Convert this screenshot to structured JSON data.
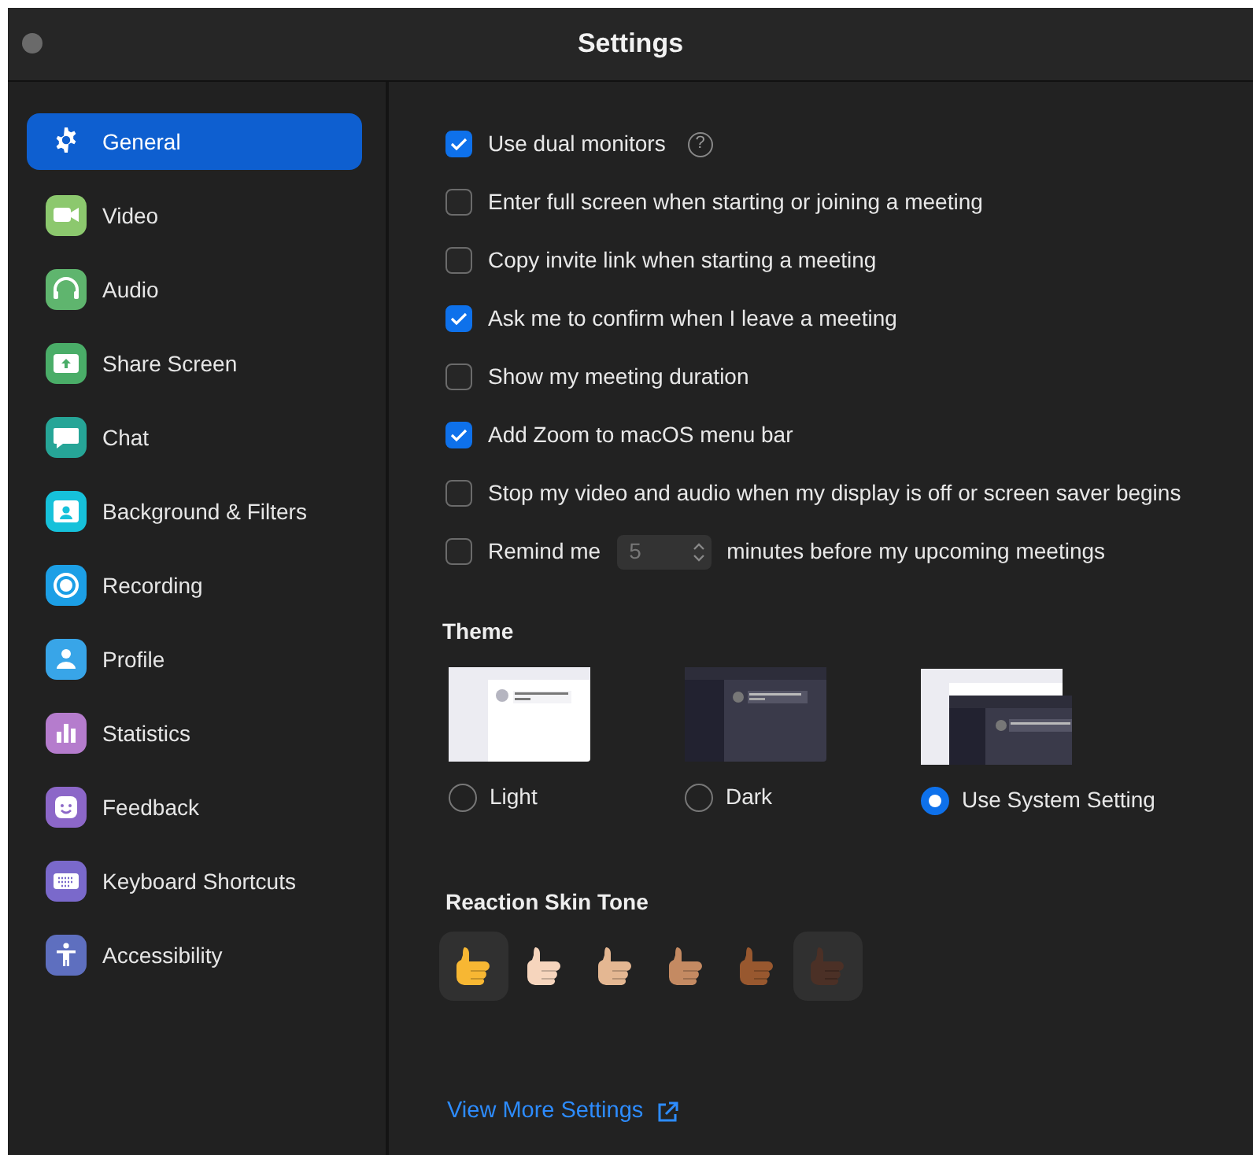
{
  "window": {
    "title": "Settings"
  },
  "sidebar": {
    "items": [
      {
        "label": "General",
        "kind": "gear",
        "selected": true
      },
      {
        "label": "Video",
        "kind": "video",
        "selected": false,
        "color": "#8cc86e"
      },
      {
        "label": "Audio",
        "kind": "headphones",
        "selected": false,
        "color": "#5fb56e"
      },
      {
        "label": "Share Screen",
        "kind": "share",
        "selected": false,
        "color": "#4aad68"
      },
      {
        "label": "Chat",
        "kind": "chat",
        "selected": false,
        "color": "#26a597"
      },
      {
        "label": "Background & Filters",
        "kind": "portrait",
        "selected": false,
        "color": "#16c1da"
      },
      {
        "label": "Recording",
        "kind": "record",
        "selected": false,
        "color": "#1c9fe6"
      },
      {
        "label": "Profile",
        "kind": "person",
        "selected": false,
        "color": "#38a5e8"
      },
      {
        "label": "Statistics",
        "kind": "bars",
        "selected": false,
        "color": "#b57ccd"
      },
      {
        "label": "Feedback",
        "kind": "smile",
        "selected": false,
        "color": "#8c67c8"
      },
      {
        "label": "Keyboard Shortcuts",
        "kind": "keyboard",
        "selected": false,
        "color": "#7a69cb"
      },
      {
        "label": "Accessibility",
        "kind": "accessibility",
        "selected": false,
        "color": "#5e6fbf"
      }
    ]
  },
  "options": [
    {
      "kind": "checkbox",
      "label": "Use dual monitors",
      "checked": true,
      "help": "?"
    },
    {
      "kind": "checkbox",
      "label": "Enter full screen when starting or joining a meeting",
      "checked": false
    },
    {
      "kind": "checkbox",
      "label": "Copy invite link when starting a meeting",
      "checked": false
    },
    {
      "kind": "checkbox",
      "label": "Ask me to confirm when I leave a meeting",
      "checked": true
    },
    {
      "kind": "checkbox",
      "label": "Show my meeting duration",
      "checked": false
    },
    {
      "kind": "checkbox",
      "label": "Add Zoom to macOS menu bar",
      "checked": true
    },
    {
      "kind": "checkbox",
      "label": "Stop my video and audio when my display is off or screen saver begins",
      "checked": false
    },
    {
      "kind": "stepper",
      "label": "Remind me",
      "value": "5",
      "suffix": "minutes before my upcoming meetings",
      "checked": false,
      "disabled": true
    }
  ],
  "theme": {
    "heading": "Theme",
    "choices": [
      {
        "label": "Light",
        "kind": "light",
        "selected": false
      },
      {
        "label": "Dark",
        "kind": "dark",
        "selected": false
      },
      {
        "label": "Use System Setting",
        "kind": "system",
        "selected": true
      }
    ]
  },
  "skin_tone": {
    "heading": "Reaction Skin Tone",
    "tones": [
      {
        "color": "#f7b733",
        "highlighted": true
      },
      {
        "color": "#f6d5bd",
        "highlighted": false
      },
      {
        "color": "#e4b792",
        "highlighted": false
      },
      {
        "color": "#c48a62",
        "highlighted": false
      },
      {
        "color": "#98582f",
        "highlighted": false
      },
      {
        "color": "#4b3026",
        "highlighted": true
      }
    ]
  },
  "link": {
    "label": "View More Settings"
  }
}
